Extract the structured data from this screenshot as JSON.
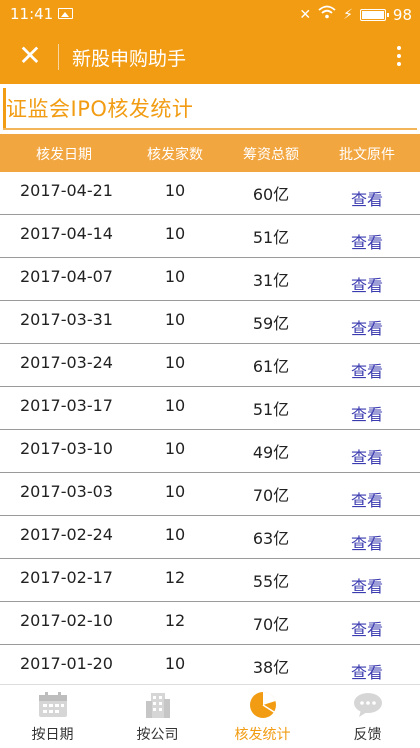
{
  "status_bar": {
    "time": "11:41",
    "battery": "98"
  },
  "app_bar": {
    "title": "新股申购助手"
  },
  "page_title": "证监会IPO核发统计",
  "table": {
    "headers": [
      "核发日期",
      "核发家数",
      "筹资总额",
      "批文原件"
    ],
    "rows": [
      [
        "2017-04-21",
        "10",
        "60亿",
        "查看"
      ],
      [
        "2017-04-14",
        "10",
        "51亿",
        "查看"
      ],
      [
        "2017-04-07",
        "10",
        "31亿",
        "查看"
      ],
      [
        "2017-03-31",
        "10",
        "59亿",
        "查看"
      ],
      [
        "2017-03-24",
        "10",
        "61亿",
        "查看"
      ],
      [
        "2017-03-17",
        "10",
        "51亿",
        "查看"
      ],
      [
        "2017-03-10",
        "10",
        "49亿",
        "查看"
      ],
      [
        "2017-03-03",
        "10",
        "70亿",
        "查看"
      ],
      [
        "2017-02-24",
        "10",
        "63亿",
        "查看"
      ],
      [
        "2017-02-17",
        "12",
        "55亿",
        "查看"
      ],
      [
        "2017-02-10",
        "12",
        "70亿",
        "查看"
      ],
      [
        "2017-01-20",
        "10",
        "38亿",
        "查看"
      ]
    ]
  },
  "bottom_nav": {
    "items": [
      {
        "label": "按日期",
        "icon": "calendar-icon"
      },
      {
        "label": "按公司",
        "icon": "building-icon"
      },
      {
        "label": "核发统计",
        "icon": "pie-chart-icon"
      },
      {
        "label": "反馈",
        "icon": "chat-bubble-icon"
      }
    ],
    "active_index": 2
  },
  "colors": {
    "accent": "#f19c12",
    "link": "#3b3bb0"
  }
}
